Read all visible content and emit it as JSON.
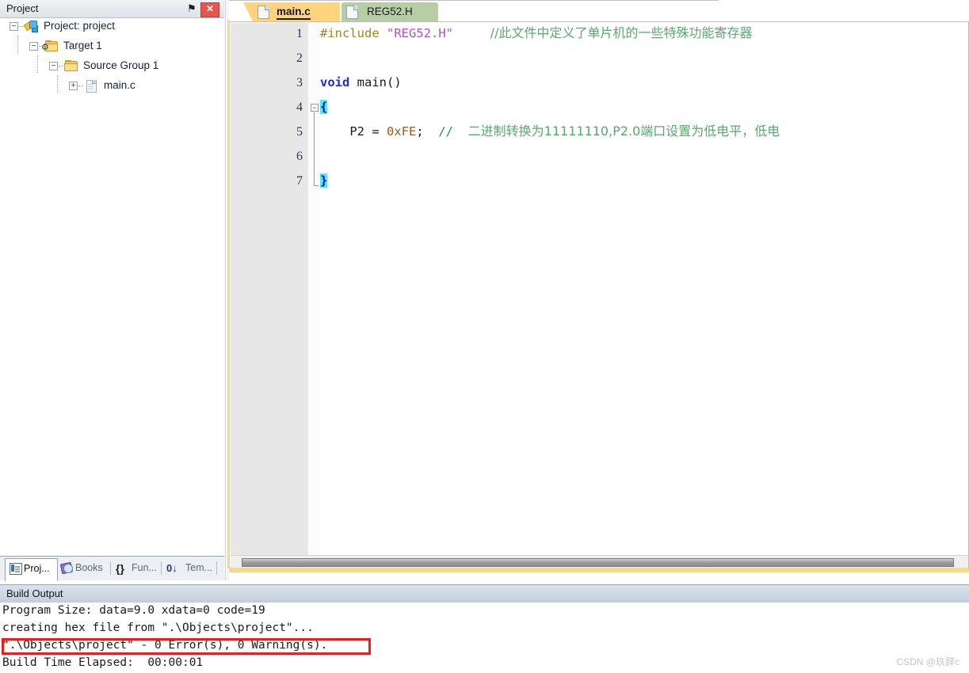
{
  "project_panel": {
    "title": "Project",
    "pin_glyph": "⚑",
    "close_glyph": "✕",
    "tree": [
      {
        "label": "Project: project",
        "expander": "−",
        "icon": "project-icon",
        "depth": 0
      },
      {
        "label": "Target 1",
        "expander": "−",
        "icon": "target-folder-icon",
        "depth": 1
      },
      {
        "label": "Source Group 1",
        "expander": "−",
        "icon": "folder-icon",
        "depth": 2
      },
      {
        "label": "main.c",
        "expander": "+",
        "icon": "c-file-icon",
        "depth": 3
      }
    ],
    "bottom_tabs": [
      {
        "label": "Proj...",
        "icon": "project-window-icon",
        "active": true
      },
      {
        "label": "Books",
        "icon": "books-icon",
        "active": false
      },
      {
        "label": "Fun...",
        "icon": "braces-icon",
        "active": false
      },
      {
        "label": "Tem...",
        "icon": "templates-icon",
        "active": false
      }
    ],
    "tab_icon_glyphs": {
      "braces": "{}",
      "templates": "0↓"
    }
  },
  "editor": {
    "tabs": [
      {
        "label": "main.c",
        "active": true,
        "color": "#ffd47f"
      },
      {
        "label": "REG52.H",
        "active": false,
        "color": "#b7cda6"
      }
    ],
    "line_numbers": [
      "1",
      "2",
      "3",
      "4",
      "5",
      "6",
      "7"
    ],
    "fold_marker": "−",
    "code": {
      "line1": {
        "directive": "#include",
        "string": "\"REG52.H\"",
        "comment": "//此文件中定义了单片机的一些特殊功能寄存器"
      },
      "line3": {
        "keyword": "void",
        "name": " main()"
      },
      "line4": {
        "brace": "{"
      },
      "line5": {
        "indent": "    ",
        "lhs": "P2 = ",
        "value": "0xFE",
        "semi": ";",
        "comment_ascii": "//  ",
        "comment": "二进制转换为11111110,P2.0端口设置为低电平，低电"
      },
      "line7": {
        "brace": "}"
      }
    }
  },
  "build_output": {
    "title": "Build Output",
    "lines": [
      "Program Size: data=9.0 xdata=0 code=19",
      "creating hex file from \".\\Objects\\project\"...",
      "\".\\Objects\\project\" - 0 Error(s), 0 Warning(s).",
      "Build Time Elapsed:  00:00:01"
    ],
    "highlight_color": "#ee1c1c",
    "highlighted_line_index": 1
  },
  "watermark": "CSDN @玖辞c"
}
